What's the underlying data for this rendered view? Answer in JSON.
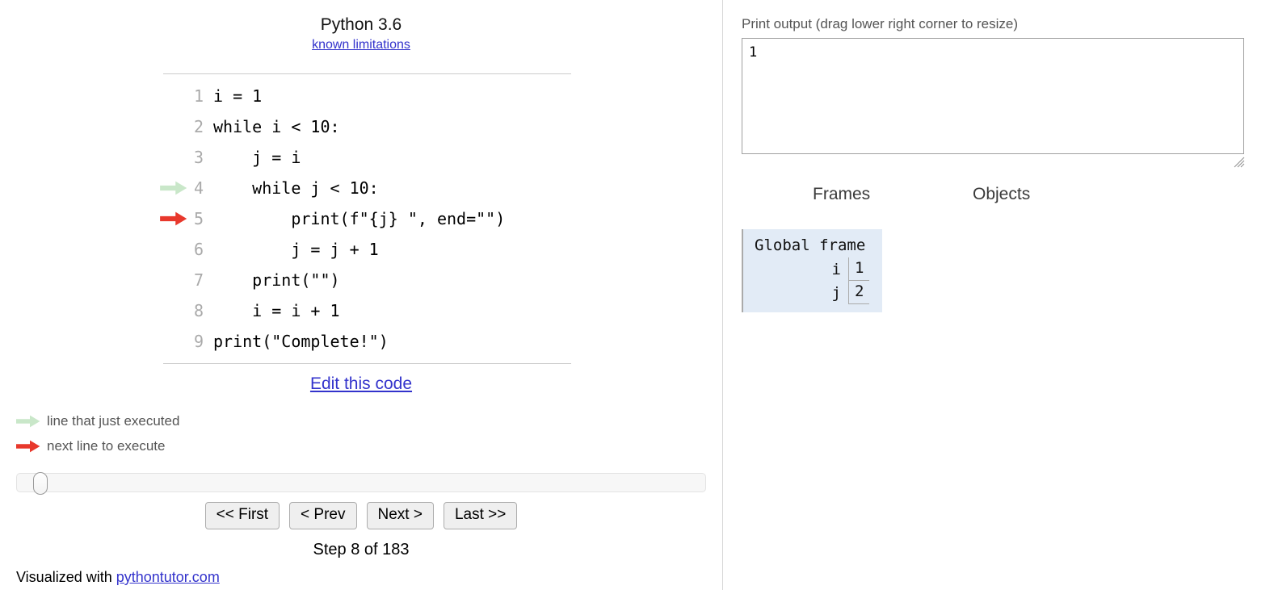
{
  "code_panel": {
    "python_version": "Python 3.6",
    "known_limitations_label": "known limitations",
    "lines": [
      {
        "num": "1",
        "text": "i = 1",
        "arrow": "none"
      },
      {
        "num": "2",
        "text": "while i < 10:",
        "arrow": "none"
      },
      {
        "num": "3",
        "text": "    j = i",
        "arrow": "none"
      },
      {
        "num": "4",
        "text": "    while j < 10:",
        "arrow": "green"
      },
      {
        "num": "5",
        "text": "        print(f\"{j} \", end=\"\")",
        "arrow": "red"
      },
      {
        "num": "6",
        "text": "        j = j + 1",
        "arrow": "none"
      },
      {
        "num": "7",
        "text": "    print(\"\")",
        "arrow": "none"
      },
      {
        "num": "8",
        "text": "    i = i + 1",
        "arrow": "none"
      },
      {
        "num": "9",
        "text": "print(\"Complete!\")",
        "arrow": "none"
      }
    ],
    "edit_link_label": "Edit this code"
  },
  "legend": {
    "green_label": "line that just executed",
    "red_label": "next line to execute",
    "green_color": "#c9e7c9",
    "red_color": "#e8382c"
  },
  "controls": {
    "first_label": "<< First",
    "prev_label": "< Prev",
    "next_label": "Next >",
    "last_label": "Last >>",
    "step_label": "Step 8 of 183",
    "slider_value": 8,
    "slider_min": 1,
    "slider_max": 183
  },
  "footer": {
    "prefix": "Visualized with ",
    "link_label": "pythontutor.com"
  },
  "output_panel": {
    "label": "Print output (drag lower right corner to resize)",
    "text": "1"
  },
  "visualization": {
    "frames_header": "Frames",
    "objects_header": "Objects",
    "frames": [
      {
        "title": "Global frame",
        "variables": [
          {
            "name": "i",
            "value": "1"
          },
          {
            "name": "j",
            "value": "2"
          }
        ]
      }
    ],
    "frame_bg_color": "#e2ebf6"
  }
}
